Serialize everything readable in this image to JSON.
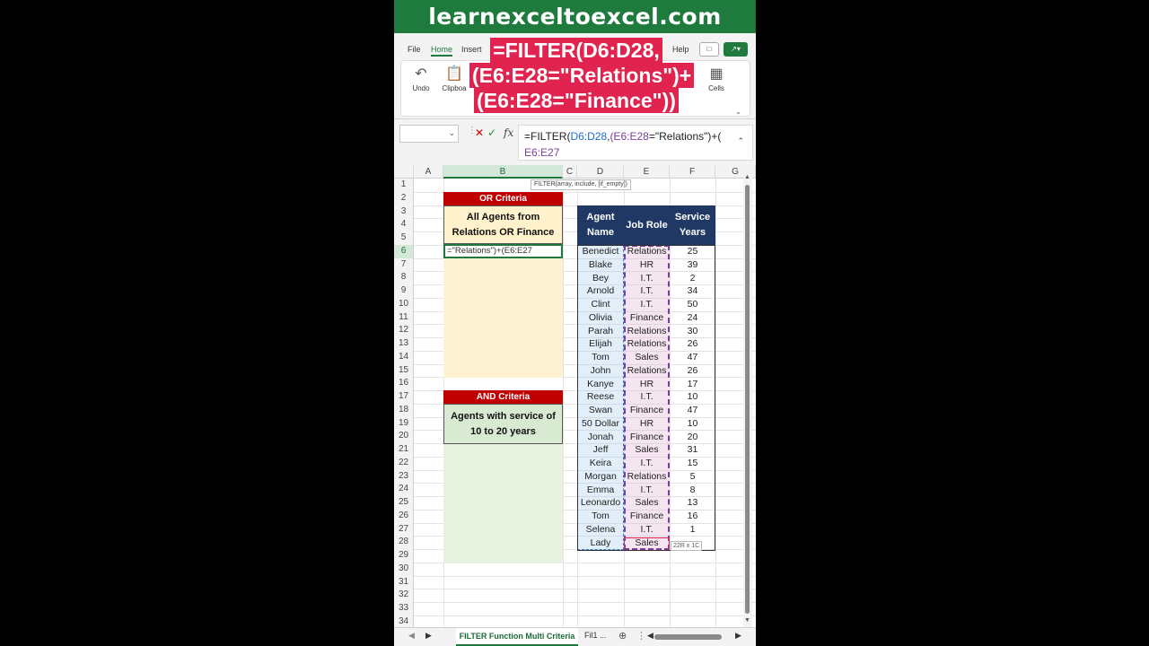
{
  "banner": "learnexceltoexcel.com",
  "ribbon": {
    "tabs": [
      "File",
      "Home",
      "Insert",
      "Help"
    ],
    "undo_label": "Undo",
    "clipboard_label": "Clipboa",
    "cells_label": "Cells"
  },
  "overlay": {
    "line1": "=FILTER(D6:D28,",
    "line2": "(E6:E28=\"Relations\")+",
    "line3": "(E6:E28=\"Finance\"))"
  },
  "formula_bar": {
    "prefix": "=FILTER(",
    "range1": "D6:D28",
    "comma": ",",
    "range2": "(E6:E28",
    "middle": "=\"Relations\")+(",
    "line2": "E6:E27"
  },
  "tooltip": "FILTER(array, include, [if_empty])",
  "columns": [
    "A",
    "B",
    "C",
    "D",
    "E",
    "F",
    "G"
  ],
  "rows": [
    "1",
    "2",
    "3",
    "4",
    "5",
    "6",
    "7",
    "8",
    "9",
    "10",
    "11",
    "12",
    "13",
    "14",
    "15",
    "16",
    "17",
    "18",
    "19",
    "20",
    "21",
    "22",
    "23",
    "24",
    "25",
    "26",
    "27",
    "28",
    "29",
    "30",
    "31",
    "32",
    "33",
    "34"
  ],
  "or_card": {
    "title": "OR Criteria",
    "body": "All Agents from Relations OR Finance",
    "edit_text": "=\"Relations\")+(E6:E27"
  },
  "and_card": {
    "title": "AND Criteria",
    "body": "Agents with service of 10 to 20 years"
  },
  "table": {
    "headers": [
      "Agent Name",
      "Job Role",
      "Service Years"
    ],
    "rows": [
      [
        "Benedict",
        "Relations",
        "25"
      ],
      [
        "Blake",
        "HR",
        "39"
      ],
      [
        "Bey",
        "I.T.",
        "2"
      ],
      [
        "Arnold",
        "I.T.",
        "34"
      ],
      [
        "Clint",
        "I.T.",
        "50"
      ],
      [
        "Olivia",
        "Finance",
        "24"
      ],
      [
        "Parah",
        "Relations",
        "30"
      ],
      [
        "Elijah",
        "Relations",
        "26"
      ],
      [
        "Tom",
        "Sales",
        "47"
      ],
      [
        "John",
        "Relations",
        "26"
      ],
      [
        "Kanye",
        "HR",
        "17"
      ],
      [
        "Reese",
        "I.T.",
        "10"
      ],
      [
        "Swan",
        "Finance",
        "47"
      ],
      [
        "50 Dollar",
        "HR",
        "10"
      ],
      [
        "Jonah",
        "Finance",
        "20"
      ],
      [
        "Jeff",
        "Sales",
        "31"
      ],
      [
        "Keira",
        "I.T.",
        "15"
      ],
      [
        "Morgan",
        "Relations",
        "5"
      ],
      [
        "Emma",
        "I.T.",
        "8"
      ],
      [
        "Leonardo",
        "Sales",
        "13"
      ],
      [
        "Tom",
        "Finance",
        "16"
      ],
      [
        "Selena",
        "I.T.",
        "1"
      ],
      [
        "Lady",
        "Sales",
        ""
      ]
    ]
  },
  "size_hint": "22R x 1C",
  "sheet_tabs": [
    "FILTER Function Multi Criteria",
    "Fil1 ..."
  ],
  "colors": {
    "banner": "#1f7a3e",
    "card_title": "#c00000",
    "header": "#1f3864",
    "overlay": "#e0244f"
  }
}
